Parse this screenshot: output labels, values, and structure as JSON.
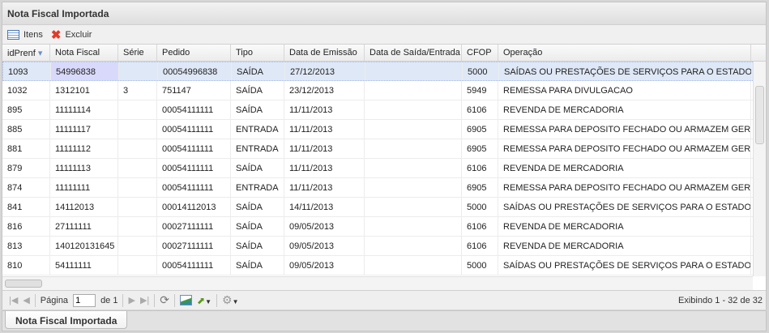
{
  "title": "Nota Fiscal Importada",
  "toolbar": {
    "itens": "Itens",
    "excluir": "Excluir"
  },
  "columns": [
    "idPrenf",
    "Nota Fiscal",
    "Série",
    "Pedido",
    "Tipo",
    "Data de Emissão",
    "Data de Saída/Entrada",
    "CFOP",
    "Operação"
  ],
  "rows": [
    [
      "1093",
      "54996838",
      "",
      "00054996838",
      "SAÍDA",
      "27/12/2013",
      "",
      "5000",
      "SAÍDAS OU PRESTAÇÕES DE SERVIÇOS PARA O ESTADO"
    ],
    [
      "1032",
      "1312101",
      "3",
      "751147",
      "SAÍDA",
      "23/12/2013",
      "",
      "5949",
      "REMESSA PARA DIVULGACAO"
    ],
    [
      "895",
      "11111114",
      "",
      "00054111111",
      "SAÍDA",
      "11/11/2013",
      "",
      "6106",
      "REVENDA DE MERCADORIA"
    ],
    [
      "885",
      "11111117",
      "",
      "00054111111",
      "ENTRADA",
      "11/11/2013",
      "",
      "6905",
      "REMESSA PARA DEPOSITO FECHADO OU ARMAZEM GERAL"
    ],
    [
      "881",
      "11111112",
      "",
      "00054111111",
      "ENTRADA",
      "11/11/2013",
      "",
      "6905",
      "REMESSA PARA DEPOSITO FECHADO OU ARMAZEM GERAL"
    ],
    [
      "879",
      "11111113",
      "",
      "00054111111",
      "SAÍDA",
      "11/11/2013",
      "",
      "6106",
      "REVENDA DE MERCADORIA"
    ],
    [
      "874",
      "11111111",
      "",
      "00054111111",
      "ENTRADA",
      "11/11/2013",
      "",
      "6905",
      "REMESSA PARA DEPOSITO FECHADO OU ARMAZEM GERAL"
    ],
    [
      "841",
      "14112013",
      "",
      "00014112013",
      "SAÍDA",
      "14/11/2013",
      "",
      "5000",
      "SAÍDAS OU PRESTAÇÕES DE SERVIÇOS PARA O ESTADO"
    ],
    [
      "816",
      "27111111",
      "",
      "00027111111",
      "SAÍDA",
      "09/05/2013",
      "",
      "6106",
      "REVENDA DE MERCADORIA"
    ],
    [
      "813",
      "140120131645",
      "",
      "00027111111",
      "SAÍDA",
      "09/05/2013",
      "",
      "6106",
      "REVENDA DE MERCADORIA"
    ],
    [
      "810",
      "54111111",
      "",
      "00054111111",
      "SAÍDA",
      "09/05/2013",
      "",
      "5000",
      "SAÍDAS OU PRESTAÇÕES DE SERVIÇOS PARA O ESTADO"
    ]
  ],
  "paging": {
    "page_label": "Página",
    "page_value": "1",
    "of_label": "de 1",
    "info": "Exibindo 1 - 32 de 32"
  },
  "tab": "Nota Fiscal Importada"
}
